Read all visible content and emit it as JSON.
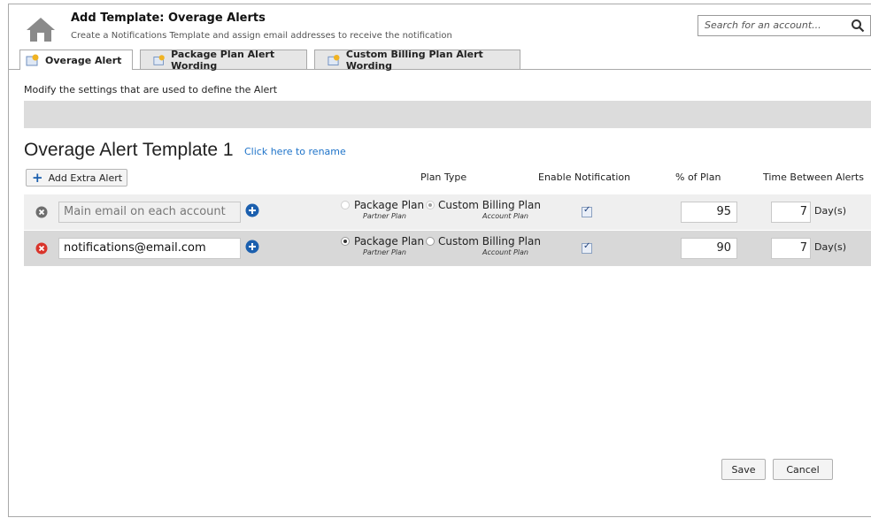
{
  "header": {
    "title": "Add Template: Overage Alerts",
    "subtitle": "Create a Notifications Template and assign email addresses to receive the notification"
  },
  "search": {
    "placeholder": "Search for an account..."
  },
  "tabs": [
    {
      "label": "Overage Alert",
      "active": true
    },
    {
      "label": "Package Plan Alert Wording",
      "active": false
    },
    {
      "label": "Custom Billing Plan Alert Wording",
      "active": false
    }
  ],
  "description": "Modify the settings that are used to define the Alert",
  "template": {
    "title": "Overage Alert Template 1",
    "rename_link": "Click here to rename"
  },
  "add_button": "Add Extra Alert",
  "columns": {
    "plan_type": "Plan Type",
    "enable": "Enable Notification",
    "pct": "% of Plan",
    "time": "Time Between Alerts"
  },
  "rows": [
    {
      "email": "Main email on each account",
      "email_disabled": true,
      "package_label": "Package Plan",
      "package_sub": "Partner Plan",
      "custom_label": "Custom Billing Plan",
      "custom_sub": "Account Plan",
      "selected": "custom",
      "enabled": true,
      "pct": "95",
      "days": "7",
      "days_unit": "Day(s)"
    },
    {
      "email": "notifications@email.com",
      "email_disabled": false,
      "package_label": "Package Plan",
      "package_sub": "Partner Plan",
      "custom_label": "Custom Billing Plan",
      "custom_sub": "Account Plan",
      "selected": "package",
      "enabled": true,
      "pct": "90",
      "days": "7",
      "days_unit": "Day(s)"
    }
  ],
  "buttons": {
    "save": "Save",
    "cancel": "Cancel"
  },
  "colors": {
    "link": "#1e73c9",
    "delete_red": "#d9342b",
    "add_blue": "#1b5fae"
  }
}
